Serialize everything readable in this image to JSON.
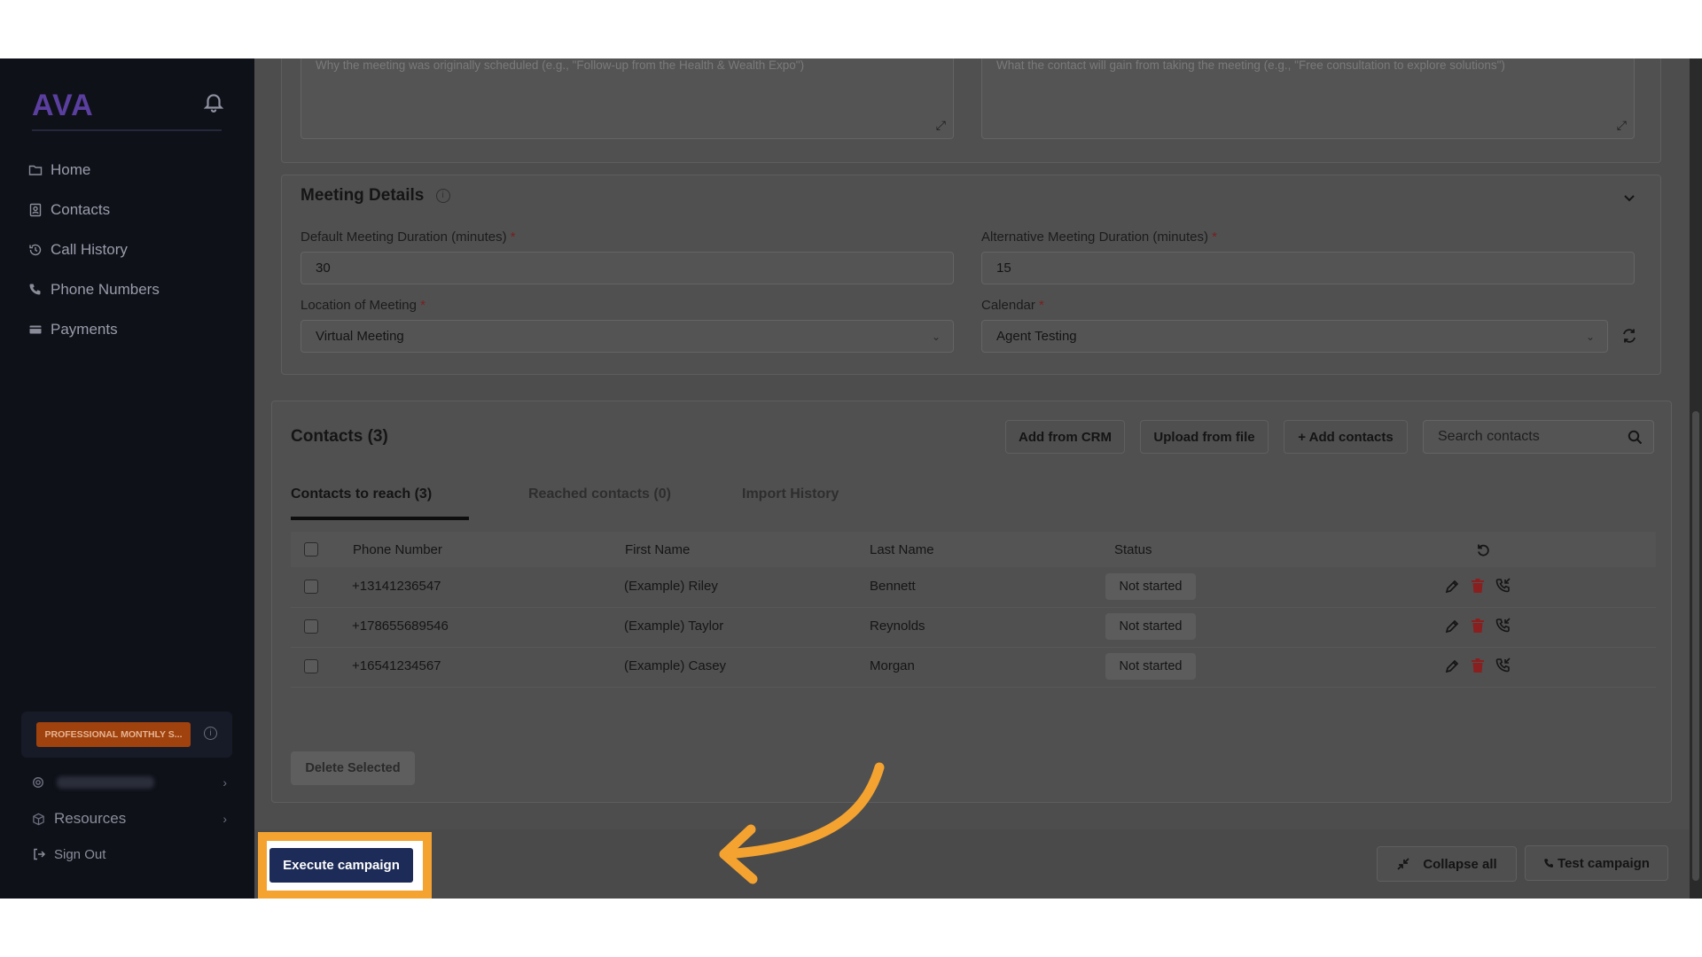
{
  "sidebar": {
    "logo": "AVA",
    "nav": [
      {
        "label": "Home",
        "icon": "folder-icon"
      },
      {
        "label": "Contacts",
        "icon": "contacts-icon"
      },
      {
        "label": "Call History",
        "icon": "history-icon"
      },
      {
        "label": "Phone Numbers",
        "icon": "phone-icon"
      },
      {
        "label": "Payments",
        "icon": "card-icon"
      }
    ],
    "plan_badge": "PROFESSIONAL MONTHLY S...",
    "resources_label": "Resources",
    "signout_label": "Sign Out"
  },
  "top_fields": {
    "reason_placeholder": "Why the meeting was originally scheduled (e.g., \"Follow-up from the Health & Wealth Expo\")",
    "benefit_placeholder": "What the contact will gain from taking the meeting (e.g., \"Free consultation to explore solutions\")"
  },
  "meeting": {
    "title": "Meeting Details",
    "default_duration_label": "Default Meeting Duration (minutes)",
    "default_duration_value": "30",
    "alt_duration_label": "Alternative Meeting Duration (minutes)",
    "alt_duration_value": "15",
    "location_label": "Location of Meeting",
    "location_value": "Virtual Meeting",
    "calendar_label": "Calendar",
    "calendar_value": "Agent Testing",
    "required_mark": "*"
  },
  "contacts": {
    "title": "Contacts (3)",
    "add_from_crm": "Add from CRM",
    "upload_from_file": "Upload from file",
    "add_contacts": "+ Add contacts",
    "search_placeholder": "Search contacts",
    "tabs": [
      "Contacts to reach (3)",
      "Reached contacts (0)",
      "Import History"
    ],
    "columns": [
      "Phone Number",
      "First Name",
      "Last Name",
      "Status"
    ],
    "rows": [
      {
        "phone": "+13141236547",
        "first": "(Example) Riley",
        "last": "Bennett",
        "status": "Not started"
      },
      {
        "phone": "+178655689546",
        "first": "(Example) Taylor",
        "last": "Reynolds",
        "status": "Not started"
      },
      {
        "phone": "+16541234567",
        "first": "(Example) Casey",
        "last": "Morgan",
        "status": "Not started"
      }
    ],
    "delete_selected": "Delete Selected"
  },
  "footer": {
    "execute": "Execute campaign",
    "collapse_all": "Collapse all",
    "test_campaign": "Test campaign"
  },
  "colors": {
    "highlight": "#f4a331",
    "execute_button": "#1c2b57",
    "plan_badge": "#a0420d",
    "delete_icon": "#8a1f1f"
  }
}
